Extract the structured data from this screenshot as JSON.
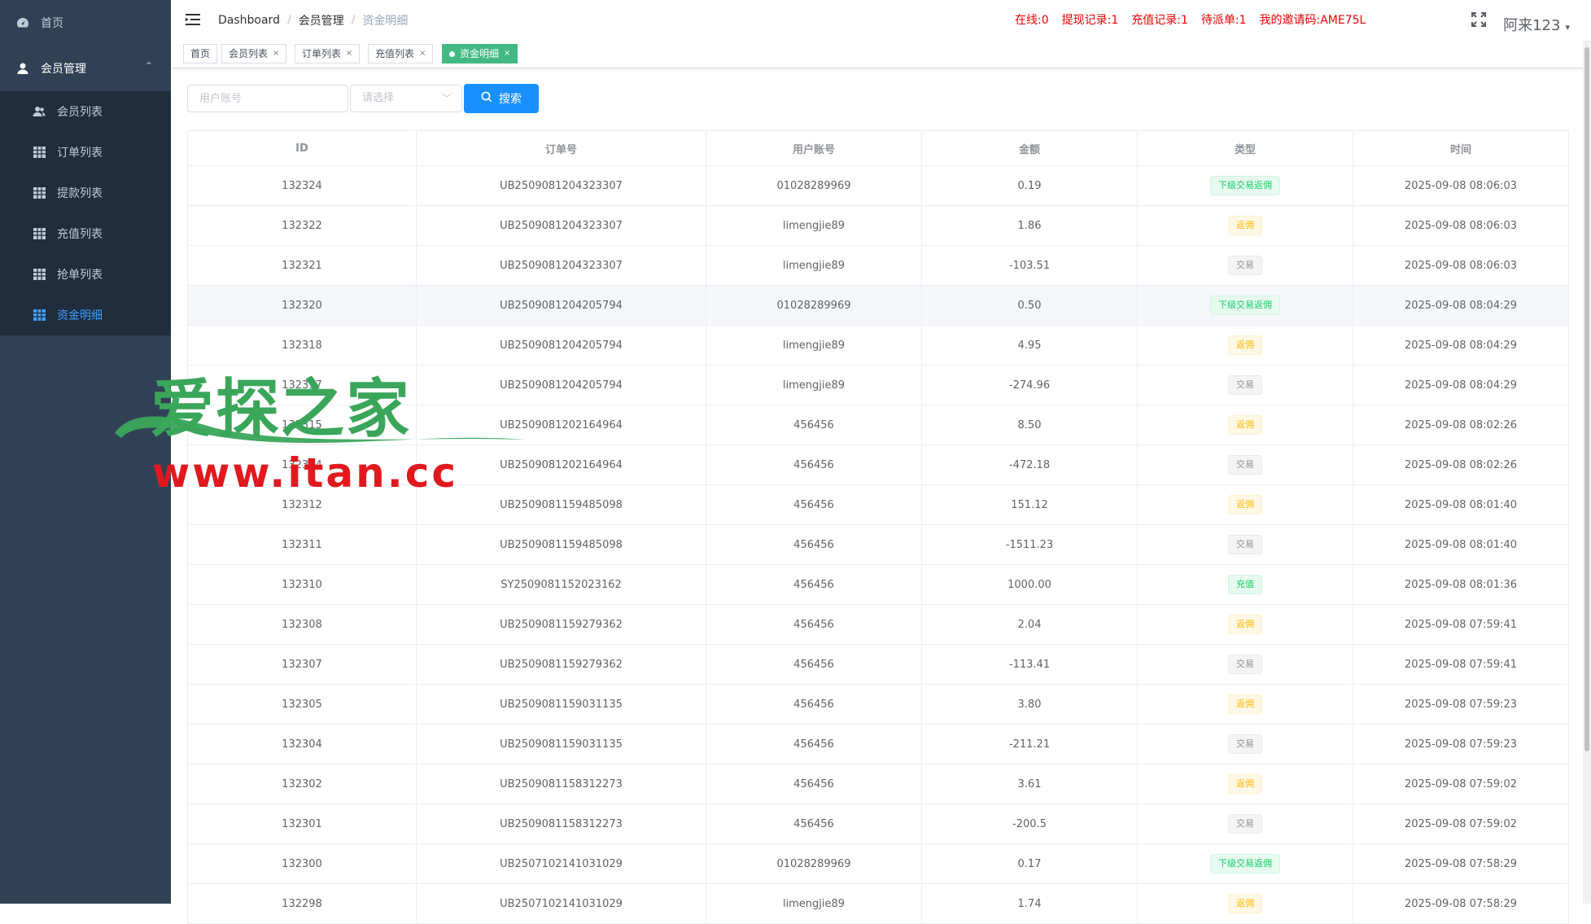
{
  "sidebar": {
    "home": "首页",
    "parent": "会员管理",
    "items": [
      {
        "label": "会员列表",
        "icon": "users-icon"
      },
      {
        "label": "订单列表",
        "icon": "table-icon"
      },
      {
        "label": "提款列表",
        "icon": "table-icon"
      },
      {
        "label": "充值列表",
        "icon": "table-icon"
      },
      {
        "label": "抢单列表",
        "icon": "table-icon"
      },
      {
        "label": "资金明细",
        "icon": "table-icon",
        "active": true
      }
    ]
  },
  "header": {
    "breadcrumb": [
      "Dashboard",
      "会员管理",
      "资金明细"
    ],
    "notices": [
      "在线:0",
      "提现记录:1",
      "充值记录:1",
      "待派单:1",
      "我的邀请码:AME75L"
    ],
    "username": "阿来123"
  },
  "tags": [
    "首页",
    "会员列表",
    "订单列表",
    "充值列表",
    "资金明细"
  ],
  "filter": {
    "account_placeholder": "用户账号",
    "select_placeholder": "请选择",
    "search_label": "搜索"
  },
  "table": {
    "columns": [
      "ID",
      "订单号",
      "用户账号",
      "金额",
      "类型",
      "时间"
    ],
    "rows": [
      [
        "132324",
        "UB2509081204323307",
        "01028289969",
        "0.19",
        "下级交易返佣",
        "2025-09-08 08:06:03"
      ],
      [
        "132322",
        "UB2509081204323307",
        "limengjie89",
        "1.86",
        "返佣",
        "2025-09-08 08:06:03"
      ],
      [
        "132321",
        "UB2509081204323307",
        "limengjie89",
        "-103.51",
        "交易",
        "2025-09-08 08:06:03"
      ],
      [
        "132320",
        "UB2509081204205794",
        "01028289969",
        "0.50",
        "下级交易返佣",
        "2025-09-08 08:04:29"
      ],
      [
        "132318",
        "UB2509081204205794",
        "limengjie89",
        "4.95",
        "返佣",
        "2025-09-08 08:04:29"
      ],
      [
        "132317",
        "UB2509081204205794",
        "limengjie89",
        "-274.96",
        "交易",
        "2025-09-08 08:04:29"
      ],
      [
        "132315",
        "UB2509081202164964",
        "456456",
        "8.50",
        "返佣",
        "2025-09-08 08:02:26"
      ],
      [
        "132314",
        "UB2509081202164964",
        "456456",
        "-472.18",
        "交易",
        "2025-09-08 08:02:26"
      ],
      [
        "132312",
        "UB2509081159485098",
        "456456",
        "151.12",
        "返佣",
        "2025-09-08 08:01:40"
      ],
      [
        "132311",
        "UB2509081159485098",
        "456456",
        "-1511.23",
        "交易",
        "2025-09-08 08:01:40"
      ],
      [
        "132310",
        "SY2509081152023162",
        "456456",
        "1000.00",
        "充值",
        "2025-09-08 08:01:36"
      ],
      [
        "132308",
        "UB2509081159279362",
        "456456",
        "2.04",
        "返佣",
        "2025-09-08 07:59:41"
      ],
      [
        "132307",
        "UB2509081159279362",
        "456456",
        "-113.41",
        "交易",
        "2025-09-08 07:59:41"
      ],
      [
        "132305",
        "UB2509081159031135",
        "456456",
        "3.80",
        "返佣",
        "2025-09-08 07:59:23"
      ],
      [
        "132304",
        "UB2509081159031135",
        "456456",
        "-211.21",
        "交易",
        "2025-09-08 07:59:23"
      ],
      [
        "132302",
        "UB2509081158312273",
        "456456",
        "3.61",
        "返佣",
        "2025-09-08 07:59:02"
      ],
      [
        "132301",
        "UB2509081158312273",
        "456456",
        "-200.5",
        "交易",
        "2025-09-08 07:59:02"
      ],
      [
        "132300",
        "UB2507102141031029",
        "01028289969",
        "0.17",
        "下级交易返佣",
        "2025-09-08 07:58:29"
      ],
      [
        "132298",
        "UB2507102141031029",
        "limengjie89",
        "1.74",
        "返佣",
        "2025-09-08 07:58:29"
      ]
    ]
  },
  "watermark": {
    "title": "爱探之家",
    "url": "www.itan.cc"
  },
  "colors": {
    "sidebar_bg": "#304156",
    "submenu_bg": "#1f2d3d",
    "active_menu": "#409eff",
    "notice_red": "#f00000",
    "tag_active": "#42b983",
    "search_button": "#1890ff"
  }
}
